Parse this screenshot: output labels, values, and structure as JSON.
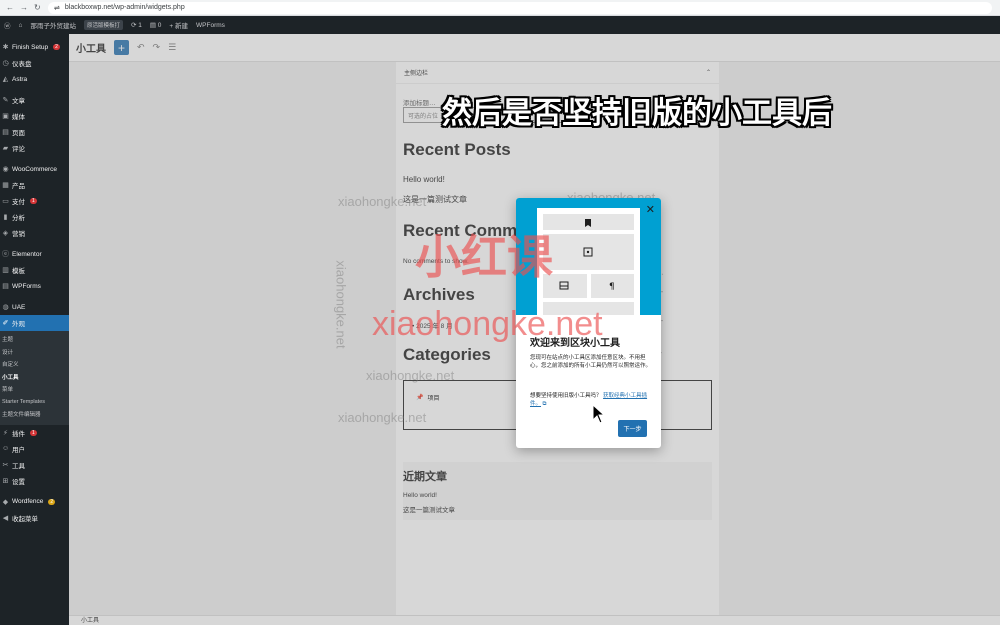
{
  "browser": {
    "url": "blackboxwp.net/wp-admin/widgets.php"
  },
  "adminbar": {
    "site": "那雨子外贸建站",
    "pill": "原活版模板打",
    "updates": "1",
    "comments": "0",
    "new": "+ 新建",
    "plugin": "WPForms"
  },
  "sidebar": {
    "items": [
      {
        "label": "Finish Setup",
        "badge": "2",
        "icon": "gear-icon"
      },
      {
        "label": "仪表盘",
        "icon": "dashboard-icon"
      },
      {
        "label": "Astra",
        "icon": "astra-icon"
      },
      {
        "label": "文章",
        "icon": "pin-icon"
      },
      {
        "label": "媒体",
        "icon": "media-icon"
      },
      {
        "label": "页面",
        "icon": "page-icon"
      },
      {
        "label": "评论",
        "icon": "comment-icon"
      },
      {
        "label": "WooCommerce",
        "icon": "woo-icon"
      },
      {
        "label": "产品",
        "icon": "product-icon"
      },
      {
        "label": "支付",
        "badge": "1",
        "icon": "payment-icon"
      },
      {
        "label": "分析",
        "icon": "analytics-icon"
      },
      {
        "label": "营销",
        "icon": "marketing-icon"
      },
      {
        "label": "Elementor",
        "icon": "elementor-icon"
      },
      {
        "label": "模板",
        "icon": "template-icon"
      },
      {
        "label": "WPForms",
        "icon": "wpforms-icon"
      },
      {
        "label": "UAE",
        "icon": "uae-icon"
      },
      {
        "label": "外观",
        "icon": "appearance-icon"
      }
    ],
    "sub": [
      "主题",
      "设计",
      "自定义",
      "小工具",
      "菜单",
      "Starter Templates",
      "主题文件编辑器"
    ],
    "lower": [
      {
        "label": "插件",
        "badge": "1",
        "icon": "plugin-icon"
      },
      {
        "label": "用户",
        "icon": "user-icon"
      },
      {
        "label": "工具",
        "icon": "tool-icon"
      },
      {
        "label": "设置",
        "icon": "settings-icon"
      },
      {
        "label": "Wordfence",
        "badge": "2",
        "icon": "wordfence-icon"
      },
      {
        "label": "收起菜单",
        "icon": "collapse-icon"
      }
    ]
  },
  "editor": {
    "title": "小工具",
    "add": "+"
  },
  "panel": {
    "area": "主侧边栏",
    "label": "添加标题…",
    "field": "可选的占位",
    "recent_posts": "Recent Posts",
    "post1": "Hello world!",
    "post2": "这是一篇测试文章",
    "recent_comments": "Recent Comm",
    "no_comments": "No comments to show.",
    "archives": "Archives",
    "archive_item": "2025 年 8 月",
    "categories": "Categories",
    "cat_item": "项目",
    "bottom_title": "近期文章",
    "bottom_post1": "Hello world!",
    "bottom_post2": "这是一篇测试文章"
  },
  "footer": "小工具",
  "subtitle": "然后是否坚持旧版的小工具后",
  "modal": {
    "title": "欢迎来到区块小工具",
    "desc": "您现可在站点的小工具区添加任意区块。不用担心，您之前添加的所有小工具仍然可以照常运作。",
    "classic_q": "想要坚持使用旧版小工具吗？",
    "classic_link": "获取经典小工具插件。",
    "next": "下一步"
  },
  "watermark": {
    "big": "小红课",
    "url": "xiaohongke.net",
    "small": "xiaohongke.net"
  }
}
